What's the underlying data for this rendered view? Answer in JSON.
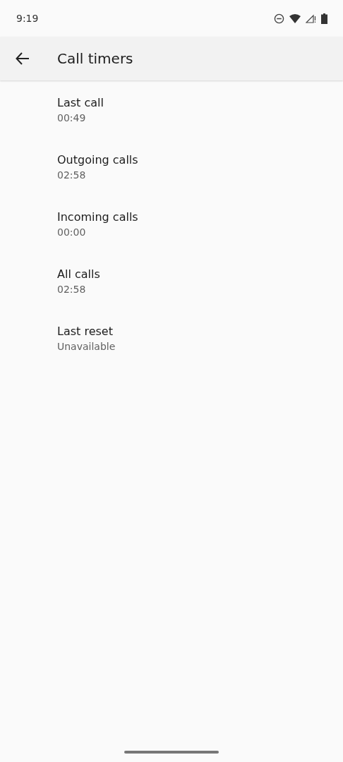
{
  "status_bar": {
    "time": "9:19"
  },
  "app_bar": {
    "title": "Call timers"
  },
  "items": [
    {
      "title": "Last call",
      "value": "00:49"
    },
    {
      "title": "Outgoing calls",
      "value": "02:58"
    },
    {
      "title": "Incoming calls",
      "value": "00:00"
    },
    {
      "title": "All calls",
      "value": "02:58"
    },
    {
      "title": "Last reset",
      "value": "Unavailable"
    }
  ]
}
